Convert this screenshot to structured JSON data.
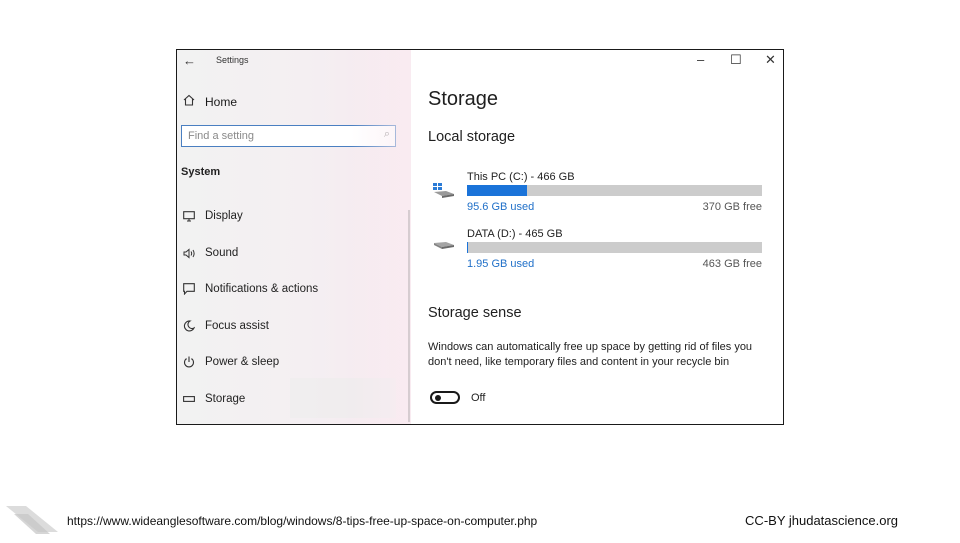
{
  "window": {
    "title": "Settings",
    "controls": {
      "minimize": "–",
      "maximize": "☐",
      "close": "✕"
    }
  },
  "sidebar": {
    "home_label": "Home",
    "search_placeholder": "Find a setting",
    "section_label": "System",
    "items": [
      {
        "label": "Display",
        "icon": "display-icon"
      },
      {
        "label": "Sound",
        "icon": "speaker-icon"
      },
      {
        "label": "Notifications & actions",
        "icon": "notification-icon"
      },
      {
        "label": "Focus assist",
        "icon": "moon-icon"
      },
      {
        "label": "Power & sleep",
        "icon": "power-icon"
      },
      {
        "label": "Storage",
        "icon": "storage-icon"
      }
    ]
  },
  "main": {
    "title": "Storage",
    "local_storage_heading": "Local storage",
    "drives": [
      {
        "name": "This PC (C:) - 466 GB",
        "used": "95.6 GB used",
        "free": "370 GB free",
        "fill_fraction": 0.205,
        "icon": "windows-drive-icon"
      },
      {
        "name": "DATA (D:) - 465 GB",
        "used": "1.95 GB used",
        "free": "463 GB free",
        "fill_fraction": 0.004,
        "icon": "drive-icon"
      }
    ],
    "storage_sense_heading": "Storage sense",
    "storage_sense_desc": "Windows can automatically free up space by getting rid of files you don't need, like temporary files and content in your recycle bin",
    "toggle_label": "Off",
    "toggle_on": false
  },
  "footer": {
    "source_url": "https://www.wideanglesoftware.com/blog/windows/8-tips-free-up-space-on-computer.php",
    "credit": "CC-BY jhudatascience.org"
  },
  "colors": {
    "accent": "#1a73d9",
    "link": "#1f6fc8",
    "search_border": "#4a7fc1"
  }
}
